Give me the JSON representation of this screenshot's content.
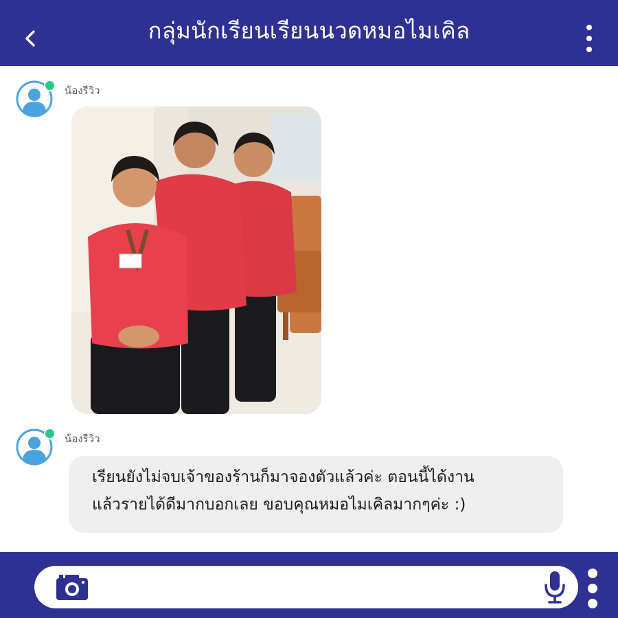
{
  "header": {
    "title": "กลุ่มนักเรียนเรียนนวดหมอไมเคิล",
    "back_icon": "chevron-left-icon",
    "menu_icon": "more-vertical-icon"
  },
  "messages": [
    {
      "sender": "น้องรีวิว",
      "type": "image",
      "image_description": "three smiling massage students in red uniforms"
    },
    {
      "sender": "น้องรีวิว",
      "type": "text",
      "lines": [
        "เรียนยังไม่จบเจ้าของร้านก็มาจองตัวแล้วค่ะ ตอนนี้ได้งาน",
        "แล้วรายได้ดีมากบอกเลย ขอบคุณหมอไมเคิลมากๆค่ะ :)"
      ]
    }
  ],
  "footer": {
    "input_value": "",
    "camera_icon": "camera-icon",
    "mic_icon": "microphone-icon",
    "menu_icon": "more-vertical-icon"
  },
  "colors": {
    "brand": "#2e3192",
    "avatar": "#4aa3df",
    "online": "#27c98a",
    "bubble": "#efefef"
  }
}
